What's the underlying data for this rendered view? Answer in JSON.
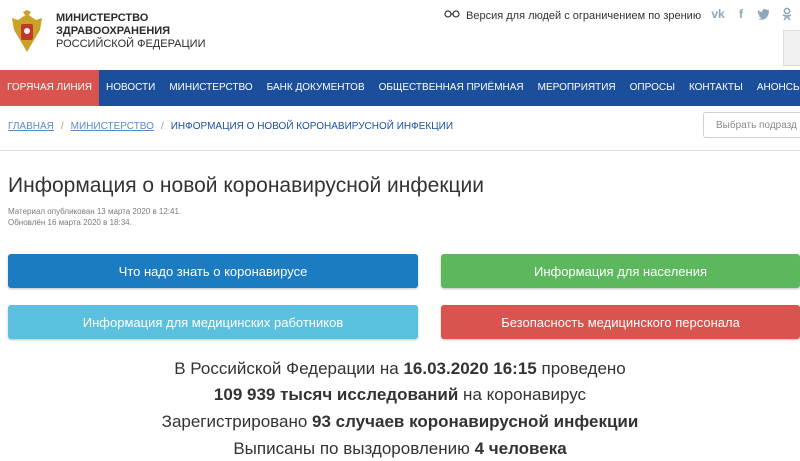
{
  "header": {
    "ministry_line1": "МИНИСТЕРСТВО",
    "ministry_line2": "ЗДРАВООХРАНЕНИЯ",
    "ministry_line3": "РОССИЙСКОЙ ФЕДЕРАЦИИ",
    "accessibility_label": "Версия для людей с ограничением по зрению",
    "social": [
      "vk-icon",
      "facebook-icon",
      "twitter-icon",
      "odnoklassniki-icon"
    ]
  },
  "nav": {
    "items": [
      "ГОРЯЧАЯ ЛИНИЯ",
      "НОВОСТИ",
      "МИНИСТЕРСТВО",
      "БАНК ДОКУМЕНТОВ",
      "ОБЩЕСТВЕННАЯ ПРИЁМНАЯ",
      "МЕРОПРИЯТИЯ",
      "ОПРОСЫ",
      "КОНТАКТЫ",
      "АНОНСЫ"
    ]
  },
  "breadcrumb": {
    "home": "ГЛАВНАЯ",
    "ministry": "МИНИСТЕРСТВО",
    "current": "ИНФОРМАЦИЯ О НОВОЙ КОРОНАВИРУСНОЙ ИНФЕКЦИИ"
  },
  "subsection_select": {
    "placeholder": "Выбрать подразд"
  },
  "page": {
    "title": "Информация о новой коронавирусной инфекции",
    "published": "Материал опубликован 13 марта 2020 в 12:41.",
    "updated": "Обновлён 16 марта 2020 в 18:34."
  },
  "buttons": {
    "what_to_know": "Что надо знать о коронавирусе",
    "population": "Информация для населения",
    "medical_workers": "Информация для медицинских работников",
    "staff_safety": "Безопасность медицинского персонала"
  },
  "stats": {
    "line1_prefix": "В Российской Федерации на ",
    "line1_date": "16.03.2020 16:15",
    "line1_suffix": " проведено",
    "line2_bold": "109 939 тысяч исследований",
    "line2_suffix": " на коронавирус",
    "line3_prefix": "Зарегистрировано ",
    "line3_bold": "93 случаев коронавирусной инфекции",
    "line4_prefix": "Выписаны по выздоровлению ",
    "line4_bold": "4 человека"
  },
  "colors": {
    "nav": "#1b4f9c",
    "hotline": "#d9534f",
    "btn_blue": "#1c7cc1",
    "btn_green": "#5cb85c",
    "btn_lightblue": "#5bc0de",
    "btn_red": "#d9534f"
  }
}
